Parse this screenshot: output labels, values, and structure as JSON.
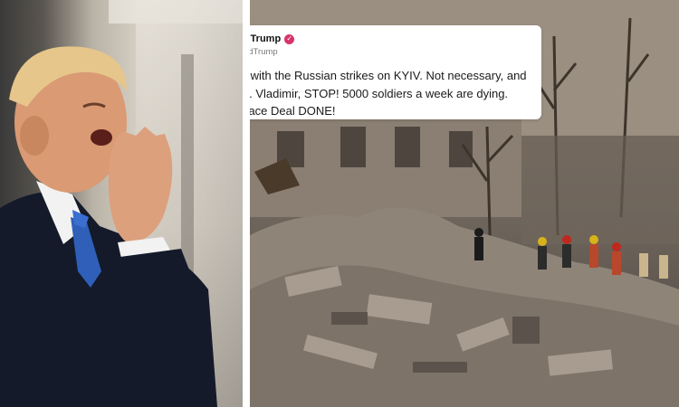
{
  "tweet": {
    "author_name": "Donald J. Trump",
    "handle": "@realDonaldTrump",
    "text": "I am not happy with the Russian strikes on KYIV. Not necessary, and very bad timing. Vladimir, STOP! 5000 soldiers a week are dying. Lets get the Peace Deal DONE!",
    "verified_icon": "verified-badge-icon",
    "verified_color": "#d6336c"
  },
  "photos": {
    "left": "portrait-photo",
    "right": "rubble-rescue-photo"
  }
}
